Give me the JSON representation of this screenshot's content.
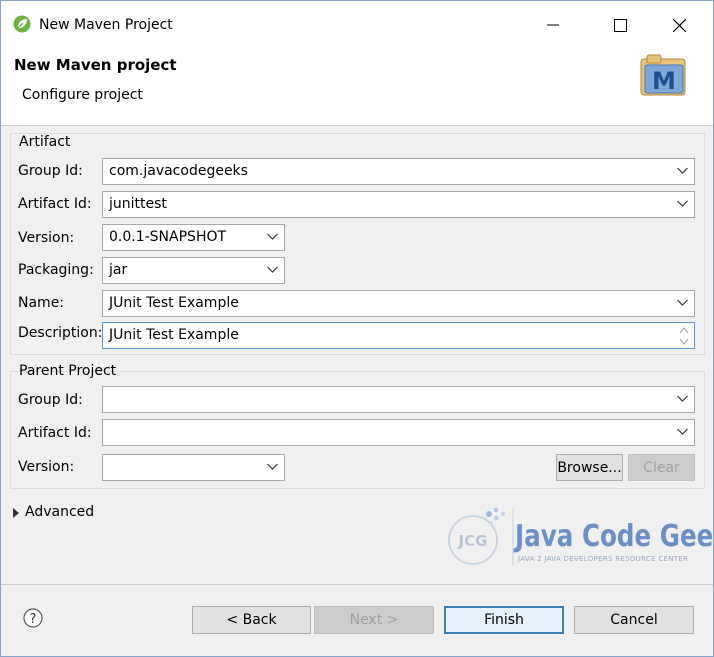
{
  "window": {
    "title": "New Maven Project"
  },
  "header": {
    "title": "New Maven project",
    "subtitle": "Configure project",
    "icon_letter": "M"
  },
  "artifact": {
    "title": "Artifact",
    "group_id": {
      "label": "Group Id:",
      "value": "com.javacodegeeks"
    },
    "artifact_id": {
      "label": "Artifact Id:",
      "value": "junittest"
    },
    "version": {
      "label": "Version:",
      "value": "0.0.1-SNAPSHOT"
    },
    "packaging": {
      "label": "Packaging:",
      "value": "jar"
    },
    "name": {
      "label": "Name:",
      "value": "JUnit Test Example"
    },
    "description": {
      "label": "Description:",
      "value": "JUnit Test Example"
    }
  },
  "parent": {
    "title": "Parent Project",
    "group_id": {
      "label": "Group Id:",
      "value": ""
    },
    "artifact_id": {
      "label": "Artifact Id:",
      "value": ""
    },
    "version": {
      "label": "Version:",
      "value": ""
    },
    "browse_label": "Browse...",
    "clear_label": "Clear"
  },
  "advanced": {
    "label": "Advanced"
  },
  "buttons": {
    "back": "< Back",
    "next": "Next >",
    "finish": "Finish",
    "cancel": "Cancel"
  },
  "watermark": {
    "brand": "Java Code Geeks",
    "tagline": "JAVA 2 JAVA DEVELOPERS RESOURCE CENTER",
    "monogram": "JCG"
  },
  "colors": {
    "accent": "#3c7fb1",
    "brand": "#6c8fc9"
  }
}
